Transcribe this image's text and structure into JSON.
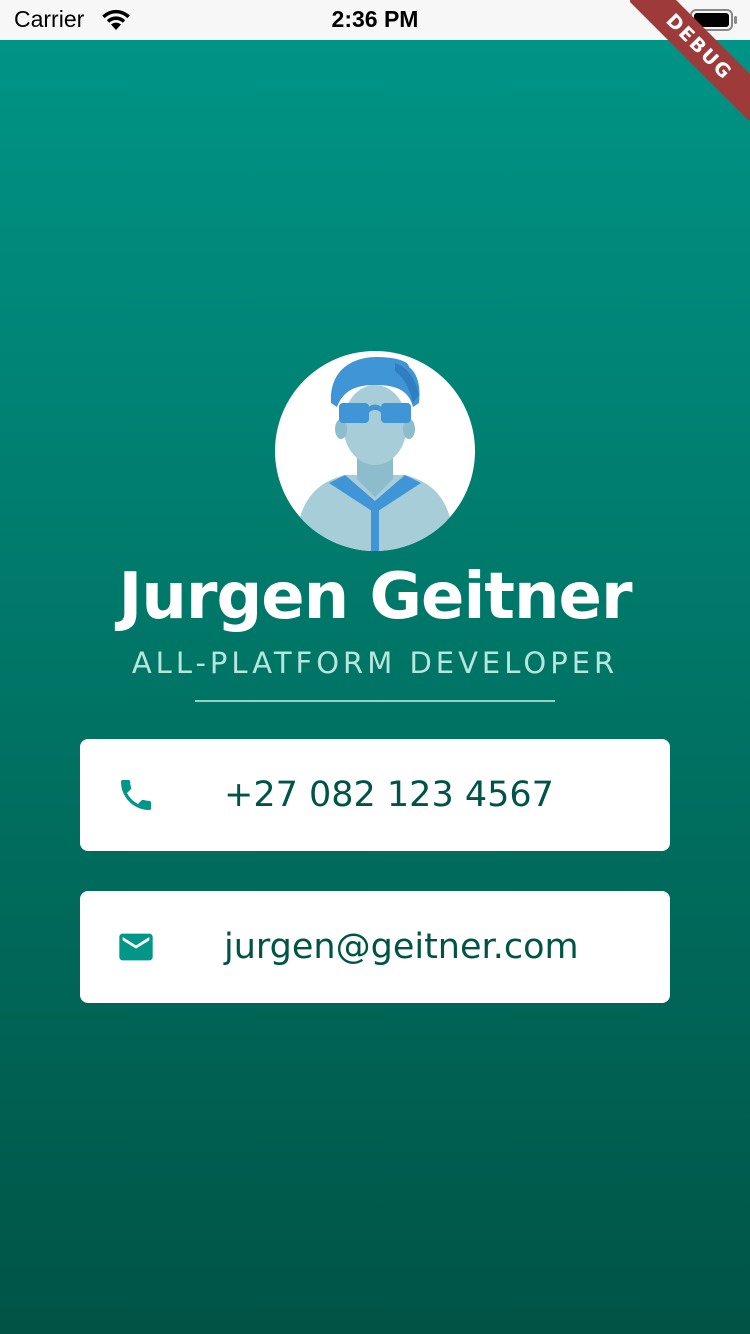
{
  "status_bar": {
    "carrier": "Carrier",
    "time": "2:36 PM",
    "wifi_icon": "wifi-icon",
    "battery_icon": "battery-icon"
  },
  "debug_banner": {
    "label": "DEBUG",
    "color": "#9e3a3a"
  },
  "profile": {
    "avatar_icon": "developer-avatar-icon",
    "name": "Jurgen Geitner",
    "title": "ALL-PLATFORM DEVELOPER"
  },
  "contacts": [
    {
      "icon": "phone-icon",
      "value": "+27 082 123 4567"
    },
    {
      "icon": "email-icon",
      "value": "jurgen@geitner.com"
    }
  ],
  "colors": {
    "accent": "#009688",
    "accent_dark": "#005446",
    "card_text": "#005446",
    "card_background": "#ffffff"
  }
}
